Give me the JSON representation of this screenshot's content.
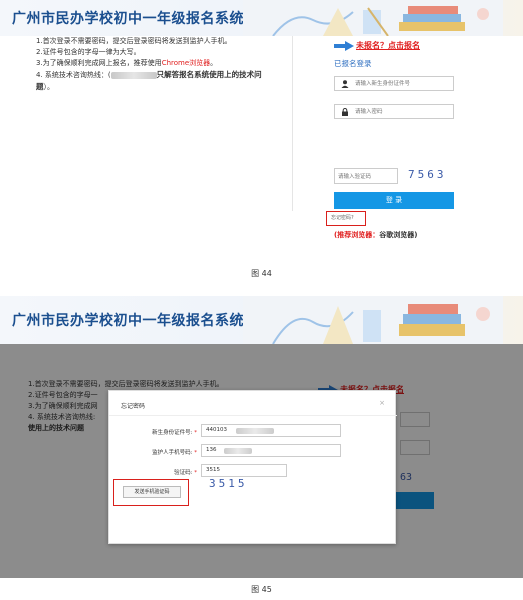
{
  "site_title": "广州市民办学校初中一年级报名系统",
  "notice": {
    "item1": "1.首次登录不需要密码，提交后登录密码将发送到监护人手机。",
    "item2": "2.证件号包含的字母一律为大写。",
    "item3_prefix": "3.为了确保顺利完成网上报名，推荐使用",
    "item3_browser": "Chrome浏览器",
    "item3_suffix": "。",
    "item4_prefix": "4. 系统技术咨询热线：(",
    "item4_bold": "只解答报名系统使用上的技术问题",
    "item4_suffix": "）。"
  },
  "login": {
    "not_registered": "未报名？点击报名",
    "registered_title": "已报名登录",
    "id_placeholder": "请输入新生身份证件号",
    "password_placeholder": "请输入密码",
    "captcha_placeholder": "请输入验证码",
    "captcha_code": "7563",
    "login_button": "登 录",
    "forgot_password": "忘记密码?",
    "browser_tip_label": "(推荐浏览器：",
    "browser_tip_value": "谷歌浏览器)"
  },
  "caption1": "图 44",
  "modal": {
    "title": "忘记密码",
    "close": "×",
    "id_label": "新生身份证件号:",
    "id_value": "440103",
    "phone_label": "监护人手机号码:",
    "phone_value": "136",
    "captcha_label": "验证码:",
    "captcha_value": "3515",
    "captcha_code": "3515",
    "send_button": "发送手机验证码"
  },
  "shot2_notice": {
    "item1": "1.首次登录不需要密码，提交后登录密码将发送到监护人手机。",
    "item2": "2.证件号包含的字母一",
    "item3": "3.为了确保顺利完成网",
    "item4": "4. 系统技术咨询热线:",
    "item5": "使用上的技术问题"
  },
  "shot2_not_registered": "未报名？点击报名",
  "shot2_captcha_fragment": "63",
  "caption2": "图 45"
}
